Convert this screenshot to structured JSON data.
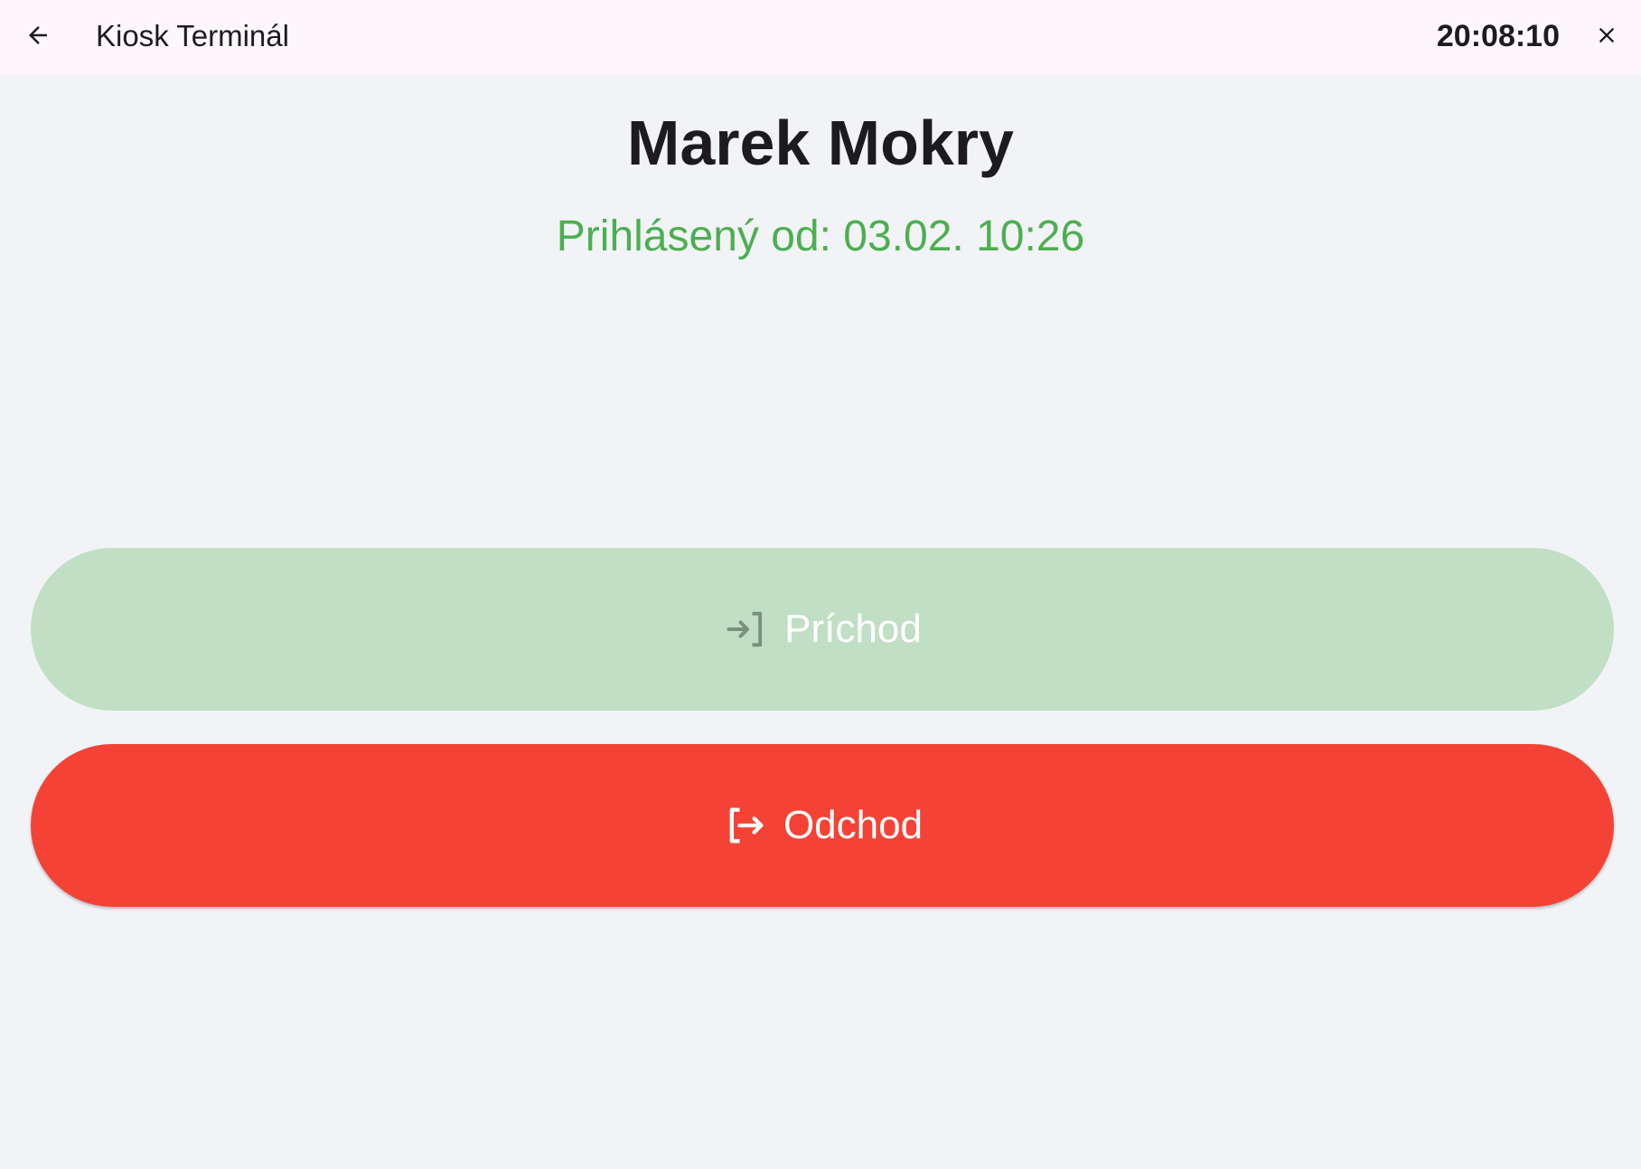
{
  "topbar": {
    "back_icon": "arrow-left-icon",
    "title": "Kiosk Terminál",
    "clock": "20:08:10",
    "close_icon": "close-icon"
  },
  "employee": {
    "name": "Marek Mokry",
    "status": "Prihlásený od: 03.02. 10:26",
    "status_color": "#4caf50"
  },
  "actions": {
    "arrival": {
      "label": "Príchod",
      "icon": "login-icon",
      "color": "#c0dfc4",
      "enabled": false
    },
    "departure": {
      "label": "Odchod",
      "icon": "logout-icon",
      "color": "#f44336",
      "enabled": true
    }
  }
}
